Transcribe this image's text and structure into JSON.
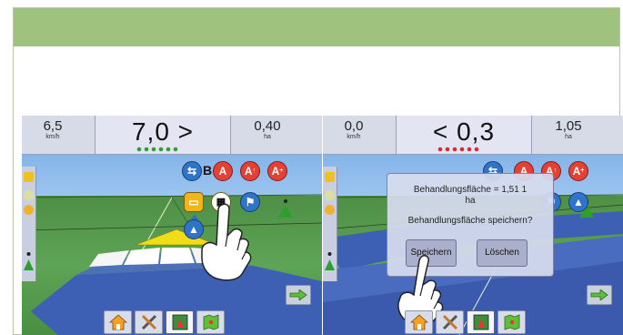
{
  "screens": [
    {
      "id": "left",
      "left_stat": {
        "value": "6,5",
        "unit": "km/h"
      },
      "center_value": "7,0 >",
      "right_stat": {
        "value": "0,40",
        "unit": "ha"
      },
      "lightbar_color": "#2e9f2e",
      "mode_letter": "B",
      "icons": [
        "swath-icon",
        "a-plus-icon",
        "a-arrow-icon",
        "a-line-icon",
        "coverage-icon",
        "finish-flag-icon",
        "flag-plus-icon",
        "marker-icon"
      ],
      "bottom_nav": [
        "home-icon",
        "tools-icon",
        "guidance-icon",
        "map-icon"
      ],
      "next_arrow": "right-arrow-icon",
      "gesture": "hand-pointer-icon"
    },
    {
      "id": "right",
      "left_stat": {
        "value": "0,0",
        "unit": "km/h"
      },
      "center_value": "< 0,3",
      "right_stat": {
        "value": "1,05",
        "unit": "ha"
      },
      "lightbar_color": "#d03030",
      "icons": [
        "swath-icon",
        "a-plus-icon",
        "a-arrow-icon",
        "a-line-icon",
        "flag-plus-icon",
        "marker-icon"
      ],
      "bottom_nav": [
        "home-icon",
        "tools-icon",
        "guidance-icon",
        "map-icon"
      ],
      "next_arrow": "right-arrow-icon",
      "gesture": "hand-pointer-icon",
      "dialog": {
        "area_label": "Behandlungsfläche = 1,51 1",
        "area_unit": "ha",
        "question": "Behandlungsfläche speichern?",
        "save_button": "Speichern",
        "delete_button": "Löschen"
      }
    }
  ],
  "colors": {
    "header_band": "#9fc37f",
    "grass": "#5ea456",
    "sky": "#8ab8ea",
    "coverage_blue": "#3d5fb4",
    "guide_yellow": "#f0dd18"
  }
}
